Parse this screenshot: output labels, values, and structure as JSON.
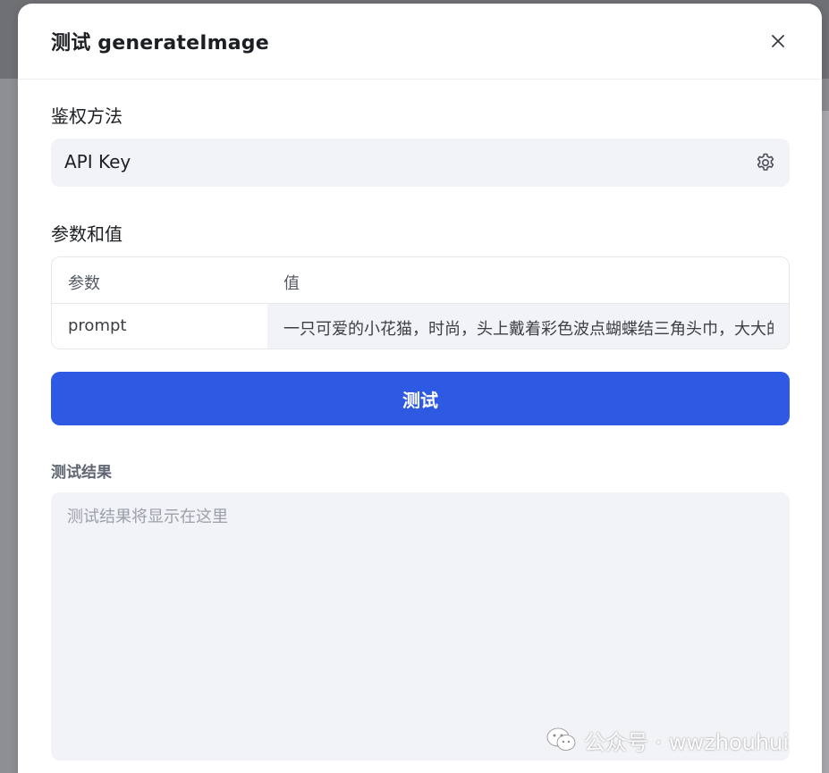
{
  "dialog": {
    "title": "测试 generateImage",
    "close_icon": "close-icon"
  },
  "auth": {
    "label": "鉴权方法",
    "value": "API Key",
    "settings_icon": "gear-icon"
  },
  "params": {
    "label": "参数和值",
    "columns": [
      "参数",
      "值"
    ],
    "rows": [
      {
        "name": "prompt",
        "value": "一只可爱的小花猫，时尚，头上戴着彩色波点蝴蝶结三角头巾，大大的"
      }
    ]
  },
  "test_button": {
    "label": "测试",
    "color": "#2e5ae3"
  },
  "result": {
    "label": "测试结果",
    "placeholder": "测试结果将显示在这里"
  },
  "watermark": {
    "text": "公众号 · wwzhouhui",
    "icon": "wechat-icon"
  }
}
